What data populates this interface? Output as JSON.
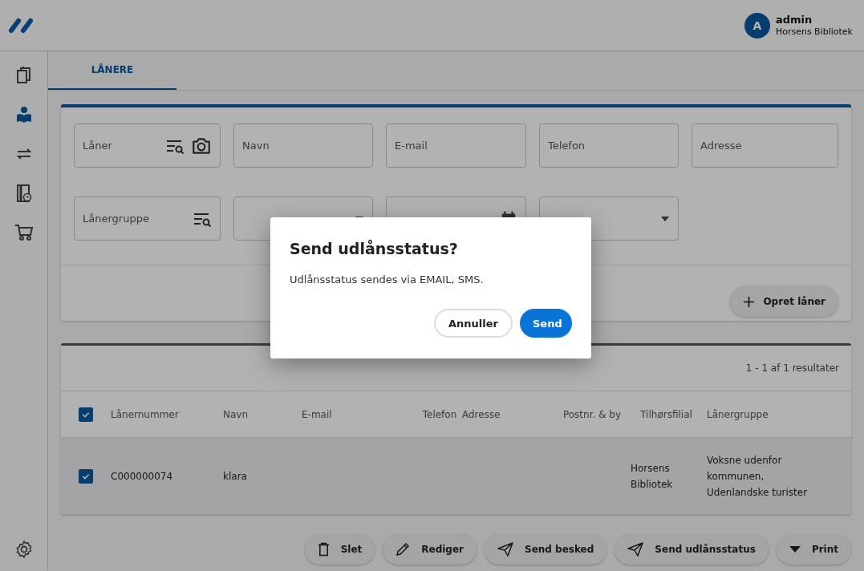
{
  "user": {
    "initial": "A",
    "name": "admin",
    "library": "Horsens Bibliotek"
  },
  "sidebar": {
    "items": [
      {
        "kind": "materials",
        "selected": false
      },
      {
        "kind": "borrowers",
        "selected": true
      },
      {
        "kind": "circulation",
        "selected": false
      },
      {
        "kind": "reservations",
        "selected": false
      },
      {
        "kind": "acquisition",
        "selected": false
      }
    ]
  },
  "tabs": [
    {
      "label": "LÅNERE",
      "selected": true
    }
  ],
  "search_fields": [
    {
      "placeholder": "Låner",
      "kind": "lookup-camera"
    },
    {
      "placeholder": "Navn",
      "kind": "text"
    },
    {
      "placeholder": "E-mail",
      "kind": "text"
    },
    {
      "placeholder": "Telefon",
      "kind": "text"
    },
    {
      "placeholder": "Adresse",
      "kind": "text"
    },
    {
      "placeholder": "Lånergruppe",
      "kind": "lookup"
    },
    {
      "kind": "select"
    },
    {
      "kind": "date"
    },
    {
      "kind": "select"
    }
  ],
  "create_button": "Opret låner",
  "results": {
    "count": "1 - 1 af 1 resultater",
    "all_selected": true,
    "columns": [
      "Lånernummer",
      "Navn",
      "E-mail",
      "Telefon",
      "Adresse",
      "Postnr. & by",
      "Tilhørsfilial",
      "Lånergruppe"
    ],
    "rows": [
      {
        "selected": true,
        "cells": [
          "C000000074",
          "klara",
          "",
          "",
          "",
          "",
          "Horsens Bibliotek",
          "Voksne udenfor kommunen, Udenlandske turister"
        ]
      }
    ]
  },
  "actions": [
    {
      "label": "Slet",
      "kind": "delete"
    },
    {
      "label": "Rediger",
      "kind": "edit"
    },
    {
      "label": "Send besked",
      "kind": "send"
    },
    {
      "label": "Send udlånsstatus",
      "kind": "send"
    },
    {
      "label": "Print",
      "kind": "menu"
    }
  ],
  "dialog": {
    "title": "Send udlånsstatus?",
    "message": "Udlånsstatus sendes via EMAIL, SMS.",
    "cancel": "Annuller",
    "confirm": "Send"
  }
}
